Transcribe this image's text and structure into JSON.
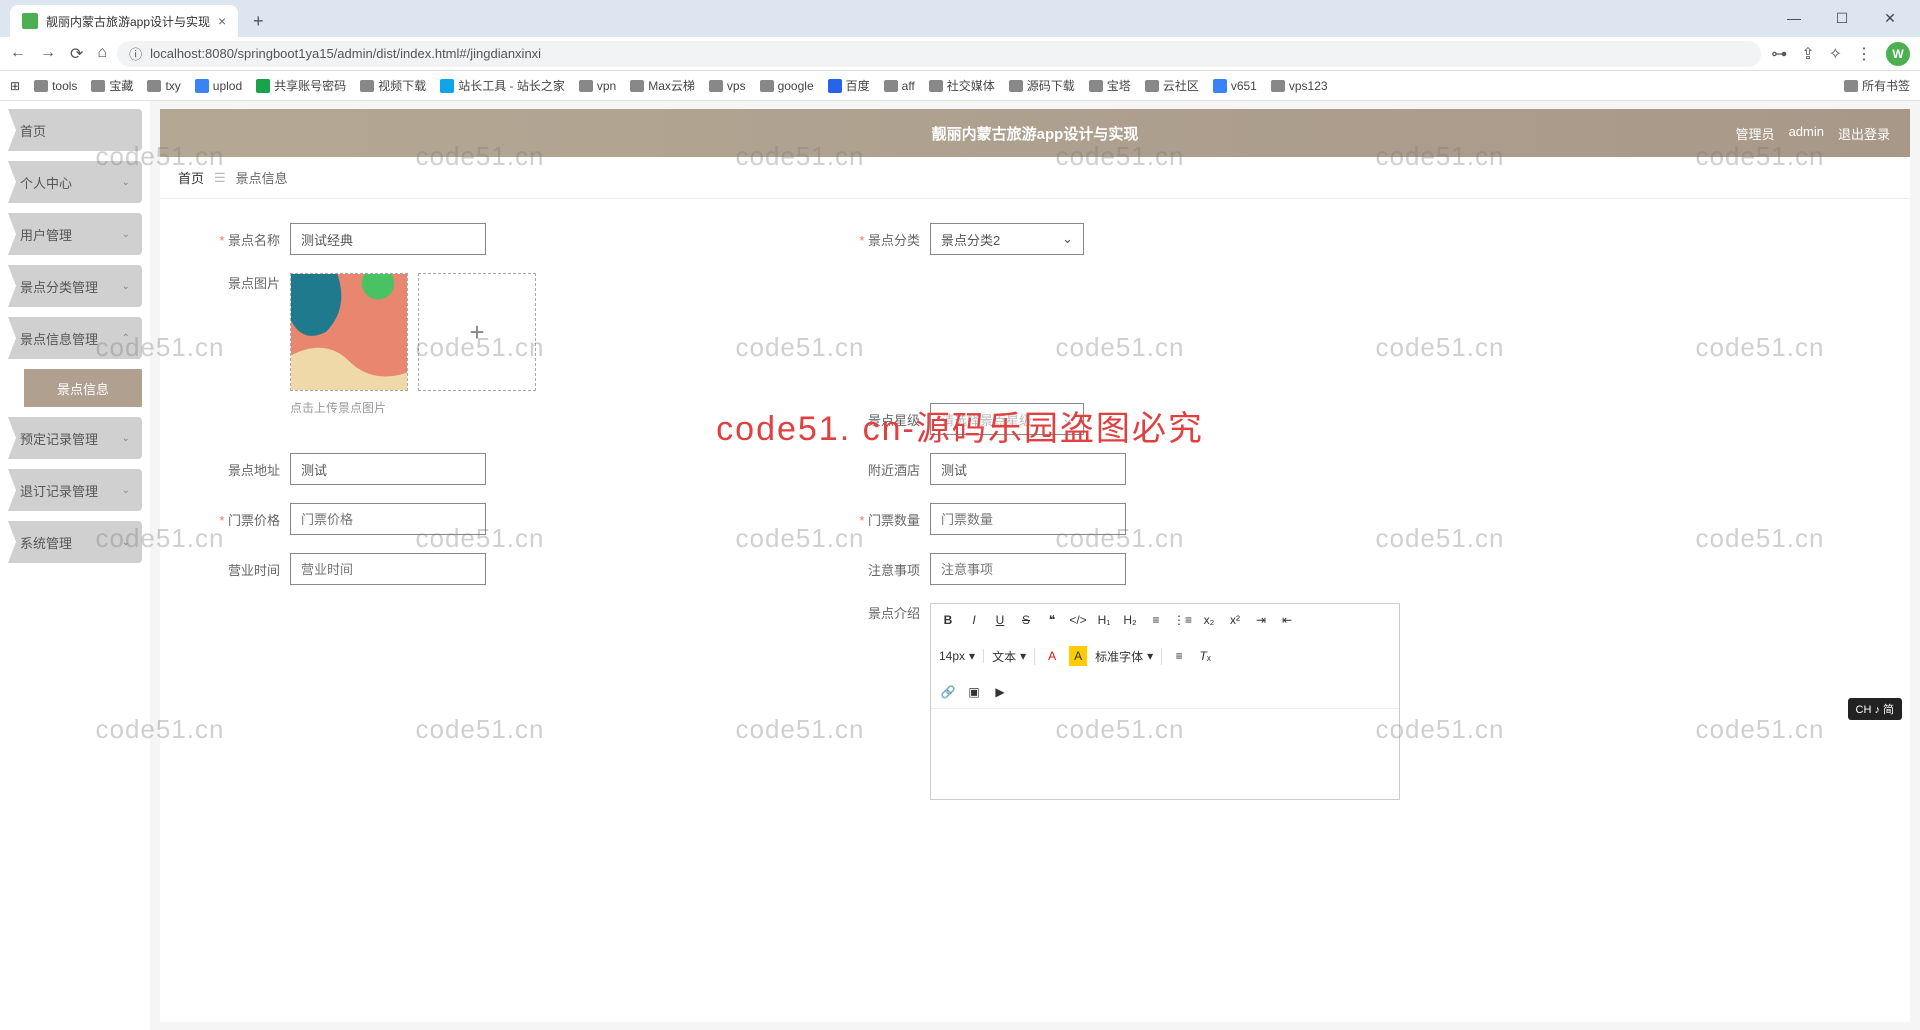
{
  "browser": {
    "tab_title": "靓丽内蒙古旅游app设计与实现",
    "url": "localhost:8080/springboot1ya15/admin/dist/index.html#/jingdianxinxi",
    "avatar_letter": "W"
  },
  "bookmarks": {
    "items": [
      "tools",
      "宝藏",
      "txy",
      "uplod",
      "共享账号密码",
      "视频下载",
      "站长工具 - 站长之家",
      "vpn",
      "Max云梯",
      "vps",
      "google",
      "百度",
      "aff",
      "社交媒体",
      "源码下载",
      "宝塔",
      "云社区",
      "v651",
      "vps123"
    ],
    "right": "所有书签"
  },
  "sidebar": {
    "items": [
      {
        "label": "首页",
        "chev": false
      },
      {
        "label": "个人中心",
        "chev": true
      },
      {
        "label": "用户管理",
        "chev": true
      },
      {
        "label": "景点分类管理",
        "chev": true
      },
      {
        "label": "景点信息管理",
        "chev": true,
        "expanded": true,
        "sub": "景点信息"
      },
      {
        "label": "预定记录管理",
        "chev": true
      },
      {
        "label": "退订记录管理",
        "chev": true
      },
      {
        "label": "系统管理",
        "chev": true
      }
    ]
  },
  "banner": {
    "title": "靓丽内蒙古旅游app设计与实现",
    "user_role": "管理员",
    "user_name": "admin",
    "logout": "退出登录"
  },
  "breadcrumb": {
    "home": "首页",
    "current": "景点信息"
  },
  "form": {
    "name_label": "景点名称",
    "name_value": "测试经典",
    "category_label": "景点分类",
    "category_value": "景点分类2",
    "image_label": "景点图片",
    "image_hint": "点击上传景点图片",
    "star_label": "景点星级",
    "star_placeholder": "请选择景点星级",
    "address_label": "景点地址",
    "address_value": "测试",
    "hotel_label": "附近酒店",
    "hotel_value": "测试",
    "price_label": "门票价格",
    "price_placeholder": "门票价格",
    "qty_label": "门票数量",
    "qty_placeholder": "门票数量",
    "hours_label": "营业时间",
    "hours_placeholder": "营业时间",
    "notice_label": "注意事项",
    "notice_placeholder": "注意事项",
    "intro_label": "景点介绍"
  },
  "editor": {
    "font_size": "14px",
    "style": "文本",
    "font_family": "标准字体"
  },
  "watermark": {
    "text": "code51.cn",
    "center": "code51. cn-源码乐园盗图必究"
  },
  "ime_badge": "CH ♪ 简"
}
